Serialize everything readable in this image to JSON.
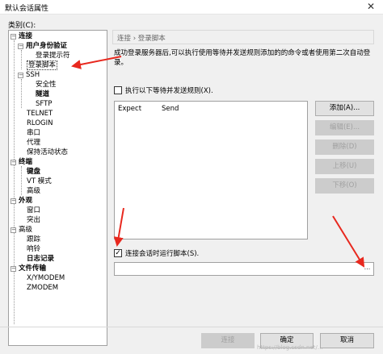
{
  "window": {
    "title": "默认会话属性",
    "close_glyph": "✕"
  },
  "category_label": "类别(C):",
  "tree": [
    {
      "label": "连接",
      "toggle": "−",
      "bold": true
    },
    {
      "label": "用户身份验证",
      "toggle": "−",
      "bold": true
    },
    {
      "label": "登录提示符"
    },
    {
      "label": "登录脚本",
      "selected": true
    },
    {
      "label": "SSH",
      "toggle": "−"
    },
    {
      "label": "安全性"
    },
    {
      "label": "隧道",
      "bold": true
    },
    {
      "label": "SFTP"
    },
    {
      "label": "TELNET"
    },
    {
      "label": "RLOGIN"
    },
    {
      "label": "串口"
    },
    {
      "label": "代理"
    },
    {
      "label": "保持活动状态"
    },
    {
      "label": "终端",
      "toggle": "−",
      "bold": true
    },
    {
      "label": "键盘",
      "bold": true
    },
    {
      "label": "VT 模式"
    },
    {
      "label": "高级"
    },
    {
      "label": "外观",
      "toggle": "−",
      "bold": true
    },
    {
      "label": "窗口"
    },
    {
      "label": "突出"
    },
    {
      "label": "高级",
      "toggle": "−"
    },
    {
      "label": "跟踪"
    },
    {
      "label": "响铃"
    },
    {
      "label": "日志记录",
      "bold": true
    },
    {
      "label": "文件传输",
      "toggle": "−",
      "bold": true
    },
    {
      "label": "X/YMODEM"
    },
    {
      "label": "ZMODEM"
    }
  ],
  "breadcrumb": "连接 › 登录脚本",
  "description": "成功登录服务器后,可以执行使用等待并发送规则添加的的命令或者使用第二次自动登录。",
  "execute_rules_checkbox": {
    "label": "执行以下等待并发送规则(X).",
    "checked": false
  },
  "rules_table": {
    "columns": [
      "Expect",
      "Send"
    ],
    "rows": []
  },
  "side_buttons": {
    "add": "添加(A)...",
    "edit": "编辑(E)...",
    "delete": "删除(D)",
    "move_up": "上移(U)",
    "move_down": "下移(O)"
  },
  "run_script_checkbox": {
    "label": "连接会话时运行脚本(S).",
    "checked": true
  },
  "script_path": {
    "value": "",
    "browse": "..."
  },
  "footer_buttons": {
    "connect": "连接",
    "ok": "确定",
    "cancel": "取消"
  },
  "watermark": "https://blog.csdn.net/...",
  "colors": {
    "annotation_arrow": "#e8281e",
    "selection_border": "#333333",
    "disabled_text": "#a0a0a0"
  }
}
